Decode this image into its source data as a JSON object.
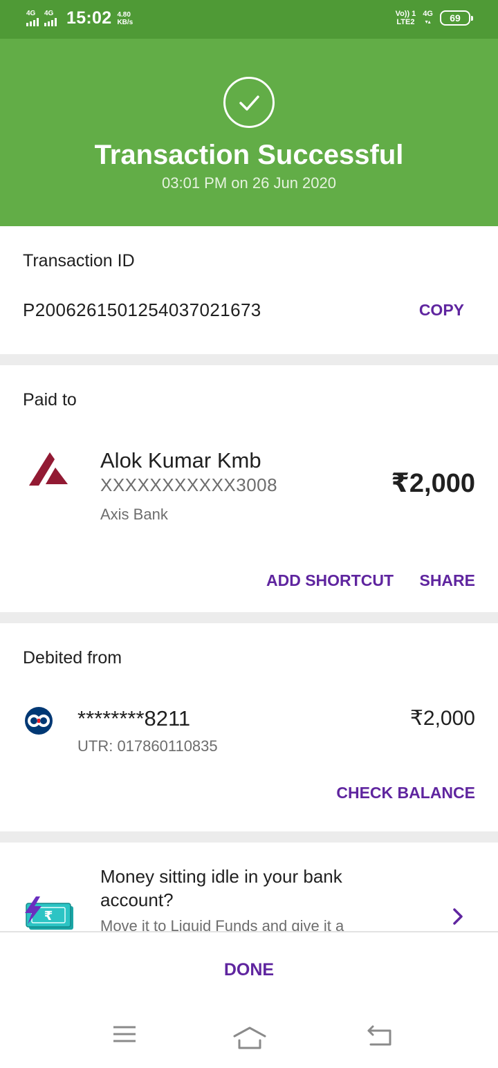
{
  "status_bar": {
    "sim1_label": "4G",
    "sim2_label": "4G",
    "time": "15:02",
    "speed_value": "4.80",
    "speed_unit": "KB/s",
    "volte_top": "Vo)) 1",
    "volte_bottom": "LTE2",
    "net_top": "4G",
    "net_bottom": "▾▴",
    "battery": "69"
  },
  "header": {
    "title": "Transaction Successful",
    "subtitle": "03:01 PM on 26 Jun 2020",
    "bg_color": "#62ad47"
  },
  "transaction": {
    "label": "Transaction ID",
    "id": "P2006261501254037021673",
    "copy_label": "COPY"
  },
  "paid_to": {
    "label": "Paid to",
    "name": "Alok Kumar Kmb",
    "account": "XXXXXXXXXXX3008",
    "bank": "Axis Bank",
    "amount": "₹2,000",
    "add_shortcut_label": "ADD SHORTCUT",
    "share_label": "SHARE",
    "bank_icon": "axis-bank-logo"
  },
  "debited_from": {
    "label": "Debited from",
    "account": "********8211",
    "utr": "UTR: 017860110835",
    "amount": "₹2,000",
    "check_balance_label": "CHECK BALANCE",
    "bank_icon": "kotak-bank-logo"
  },
  "promo": {
    "title": "Money sitting idle in your bank account?",
    "subtitle": "Move it to Liquid Funds and give it a",
    "icon": "rupee-notes-lightning-icon"
  },
  "footer": {
    "done_label": "DONE"
  },
  "accent_color": "#5f259f"
}
